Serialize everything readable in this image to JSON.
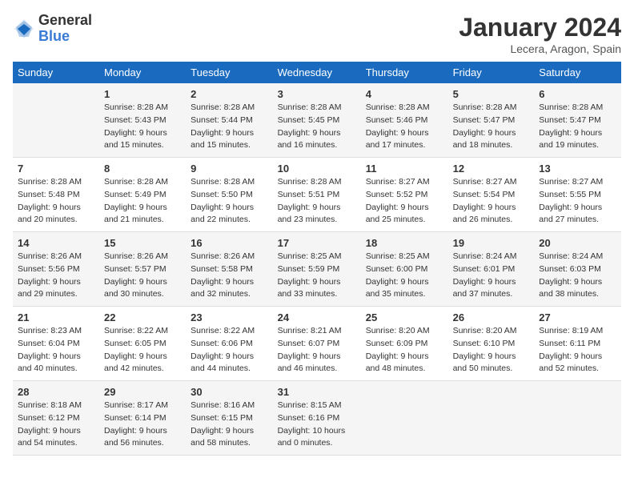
{
  "logo": {
    "general": "General",
    "blue": "Blue"
  },
  "title": "January 2024",
  "subtitle": "Lecera, Aragon, Spain",
  "headers": [
    "Sunday",
    "Monday",
    "Tuesday",
    "Wednesday",
    "Thursday",
    "Friday",
    "Saturday"
  ],
  "weeks": [
    [
      {
        "num": "",
        "sunrise": "",
        "sunset": "",
        "daylight": ""
      },
      {
        "num": "1",
        "sunrise": "Sunrise: 8:28 AM",
        "sunset": "Sunset: 5:43 PM",
        "daylight": "Daylight: 9 hours and 15 minutes."
      },
      {
        "num": "2",
        "sunrise": "Sunrise: 8:28 AM",
        "sunset": "Sunset: 5:44 PM",
        "daylight": "Daylight: 9 hours and 15 minutes."
      },
      {
        "num": "3",
        "sunrise": "Sunrise: 8:28 AM",
        "sunset": "Sunset: 5:45 PM",
        "daylight": "Daylight: 9 hours and 16 minutes."
      },
      {
        "num": "4",
        "sunrise": "Sunrise: 8:28 AM",
        "sunset": "Sunset: 5:46 PM",
        "daylight": "Daylight: 9 hours and 17 minutes."
      },
      {
        "num": "5",
        "sunrise": "Sunrise: 8:28 AM",
        "sunset": "Sunset: 5:47 PM",
        "daylight": "Daylight: 9 hours and 18 minutes."
      },
      {
        "num": "6",
        "sunrise": "Sunrise: 8:28 AM",
        "sunset": "Sunset: 5:47 PM",
        "daylight": "Daylight: 9 hours and 19 minutes."
      }
    ],
    [
      {
        "num": "7",
        "sunrise": "Sunrise: 8:28 AM",
        "sunset": "Sunset: 5:48 PM",
        "daylight": "Daylight: 9 hours and 20 minutes."
      },
      {
        "num": "8",
        "sunrise": "Sunrise: 8:28 AM",
        "sunset": "Sunset: 5:49 PM",
        "daylight": "Daylight: 9 hours and 21 minutes."
      },
      {
        "num": "9",
        "sunrise": "Sunrise: 8:28 AM",
        "sunset": "Sunset: 5:50 PM",
        "daylight": "Daylight: 9 hours and 22 minutes."
      },
      {
        "num": "10",
        "sunrise": "Sunrise: 8:28 AM",
        "sunset": "Sunset: 5:51 PM",
        "daylight": "Daylight: 9 hours and 23 minutes."
      },
      {
        "num": "11",
        "sunrise": "Sunrise: 8:27 AM",
        "sunset": "Sunset: 5:52 PM",
        "daylight": "Daylight: 9 hours and 25 minutes."
      },
      {
        "num": "12",
        "sunrise": "Sunrise: 8:27 AM",
        "sunset": "Sunset: 5:54 PM",
        "daylight": "Daylight: 9 hours and 26 minutes."
      },
      {
        "num": "13",
        "sunrise": "Sunrise: 8:27 AM",
        "sunset": "Sunset: 5:55 PM",
        "daylight": "Daylight: 9 hours and 27 minutes."
      }
    ],
    [
      {
        "num": "14",
        "sunrise": "Sunrise: 8:26 AM",
        "sunset": "Sunset: 5:56 PM",
        "daylight": "Daylight: 9 hours and 29 minutes."
      },
      {
        "num": "15",
        "sunrise": "Sunrise: 8:26 AM",
        "sunset": "Sunset: 5:57 PM",
        "daylight": "Daylight: 9 hours and 30 minutes."
      },
      {
        "num": "16",
        "sunrise": "Sunrise: 8:26 AM",
        "sunset": "Sunset: 5:58 PM",
        "daylight": "Daylight: 9 hours and 32 minutes."
      },
      {
        "num": "17",
        "sunrise": "Sunrise: 8:25 AM",
        "sunset": "Sunset: 5:59 PM",
        "daylight": "Daylight: 9 hours and 33 minutes."
      },
      {
        "num": "18",
        "sunrise": "Sunrise: 8:25 AM",
        "sunset": "Sunset: 6:00 PM",
        "daylight": "Daylight: 9 hours and 35 minutes."
      },
      {
        "num": "19",
        "sunrise": "Sunrise: 8:24 AM",
        "sunset": "Sunset: 6:01 PM",
        "daylight": "Daylight: 9 hours and 37 minutes."
      },
      {
        "num": "20",
        "sunrise": "Sunrise: 8:24 AM",
        "sunset": "Sunset: 6:03 PM",
        "daylight": "Daylight: 9 hours and 38 minutes."
      }
    ],
    [
      {
        "num": "21",
        "sunrise": "Sunrise: 8:23 AM",
        "sunset": "Sunset: 6:04 PM",
        "daylight": "Daylight: 9 hours and 40 minutes."
      },
      {
        "num": "22",
        "sunrise": "Sunrise: 8:22 AM",
        "sunset": "Sunset: 6:05 PM",
        "daylight": "Daylight: 9 hours and 42 minutes."
      },
      {
        "num": "23",
        "sunrise": "Sunrise: 8:22 AM",
        "sunset": "Sunset: 6:06 PM",
        "daylight": "Daylight: 9 hours and 44 minutes."
      },
      {
        "num": "24",
        "sunrise": "Sunrise: 8:21 AM",
        "sunset": "Sunset: 6:07 PM",
        "daylight": "Daylight: 9 hours and 46 minutes."
      },
      {
        "num": "25",
        "sunrise": "Sunrise: 8:20 AM",
        "sunset": "Sunset: 6:09 PM",
        "daylight": "Daylight: 9 hours and 48 minutes."
      },
      {
        "num": "26",
        "sunrise": "Sunrise: 8:20 AM",
        "sunset": "Sunset: 6:10 PM",
        "daylight": "Daylight: 9 hours and 50 minutes."
      },
      {
        "num": "27",
        "sunrise": "Sunrise: 8:19 AM",
        "sunset": "Sunset: 6:11 PM",
        "daylight": "Daylight: 9 hours and 52 minutes."
      }
    ],
    [
      {
        "num": "28",
        "sunrise": "Sunrise: 8:18 AM",
        "sunset": "Sunset: 6:12 PM",
        "daylight": "Daylight: 9 hours and 54 minutes."
      },
      {
        "num": "29",
        "sunrise": "Sunrise: 8:17 AM",
        "sunset": "Sunset: 6:14 PM",
        "daylight": "Daylight: 9 hours and 56 minutes."
      },
      {
        "num": "30",
        "sunrise": "Sunrise: 8:16 AM",
        "sunset": "Sunset: 6:15 PM",
        "daylight": "Daylight: 9 hours and 58 minutes."
      },
      {
        "num": "31",
        "sunrise": "Sunrise: 8:15 AM",
        "sunset": "Sunset: 6:16 PM",
        "daylight": "Daylight: 10 hours and 0 minutes."
      },
      {
        "num": "",
        "sunrise": "",
        "sunset": "",
        "daylight": ""
      },
      {
        "num": "",
        "sunrise": "",
        "sunset": "",
        "daylight": ""
      },
      {
        "num": "",
        "sunrise": "",
        "sunset": "",
        "daylight": ""
      }
    ]
  ]
}
